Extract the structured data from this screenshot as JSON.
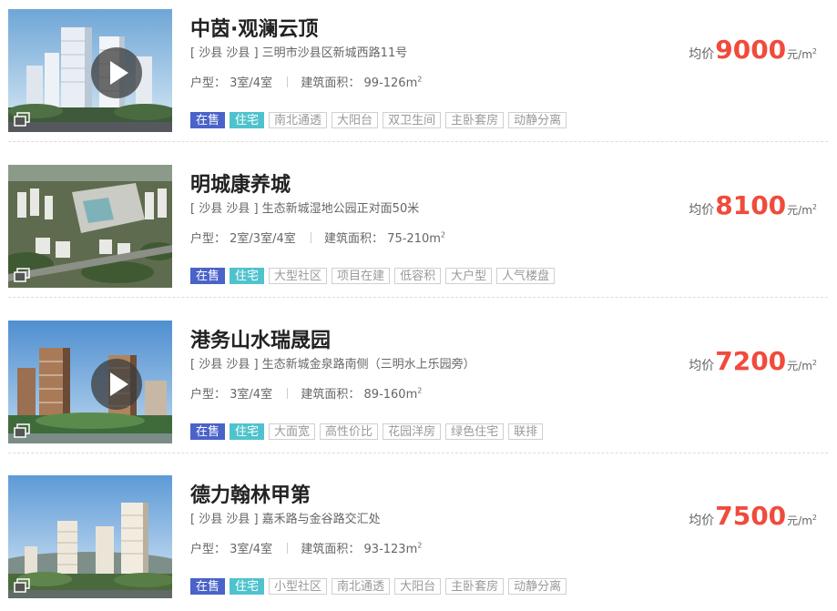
{
  "listings": [
    {
      "title": "中茵·观澜云顶",
      "address": "[ 沙县 沙县 ] 三明市沙县区新城西路11号",
      "layout_label": "户型：",
      "layout": "3室/4室",
      "area_label": "建筑面积：",
      "area": "99-126m",
      "area_sup": "2",
      "status": "在售",
      "type": "住宅",
      "features": [
        "南北通透",
        "大阳台",
        "双卫生间",
        "主卧套房",
        "动静分离"
      ],
      "price_label": "均价",
      "price": "9000",
      "price_unit": "元/m",
      "price_unit_sup": "2",
      "has_video": true
    },
    {
      "title": "明城康养城",
      "address": "[ 沙县 沙县 ] 生态新城湿地公园正对面50米",
      "layout_label": "户型：",
      "layout": "2室/3室/4室",
      "area_label": "建筑面积：",
      "area": "75-210m",
      "area_sup": "2",
      "status": "在售",
      "type": "住宅",
      "features": [
        "大型社区",
        "项目在建",
        "低容积",
        "大户型",
        "人气楼盘"
      ],
      "price_label": "均价",
      "price": "8100",
      "price_unit": "元/m",
      "price_unit_sup": "2",
      "has_video": false
    },
    {
      "title": "港务山水瑞晟园",
      "address": "[ 沙县 沙县 ] 生态新城金泉路南侧（三明水上乐园旁）",
      "layout_label": "户型：",
      "layout": "3室/4室",
      "area_label": "建筑面积：",
      "area": "89-160m",
      "area_sup": "2",
      "status": "在售",
      "type": "住宅",
      "features": [
        "大面宽",
        "高性价比",
        "花园洋房",
        "绿色住宅",
        "联排"
      ],
      "price_label": "均价",
      "price": "7200",
      "price_unit": "元/m",
      "price_unit_sup": "2",
      "has_video": true
    },
    {
      "title": "德力翰林甲第",
      "address": "[ 沙县 沙县 ] 嘉禾路与金谷路交汇处",
      "layout_label": "户型：",
      "layout": "3室/4室",
      "area_label": "建筑面积：",
      "area": "93-123m",
      "area_sup": "2",
      "status": "在售",
      "type": "住宅",
      "features": [
        "小型社区",
        "南北通透",
        "大阳台",
        "主卧套房",
        "动静分离"
      ],
      "price_label": "均价",
      "price": "7500",
      "price_unit": "元/m",
      "price_unit_sup": "2",
      "has_video": false
    }
  ],
  "colors": {
    "price": "#f04b3c",
    "status_tag": "#4a63c8",
    "type_tag": "#4fc3cd",
    "feature_tag_border": "#d0d0d0"
  },
  "icons": [
    "play-video-icon",
    "album-icon"
  ]
}
